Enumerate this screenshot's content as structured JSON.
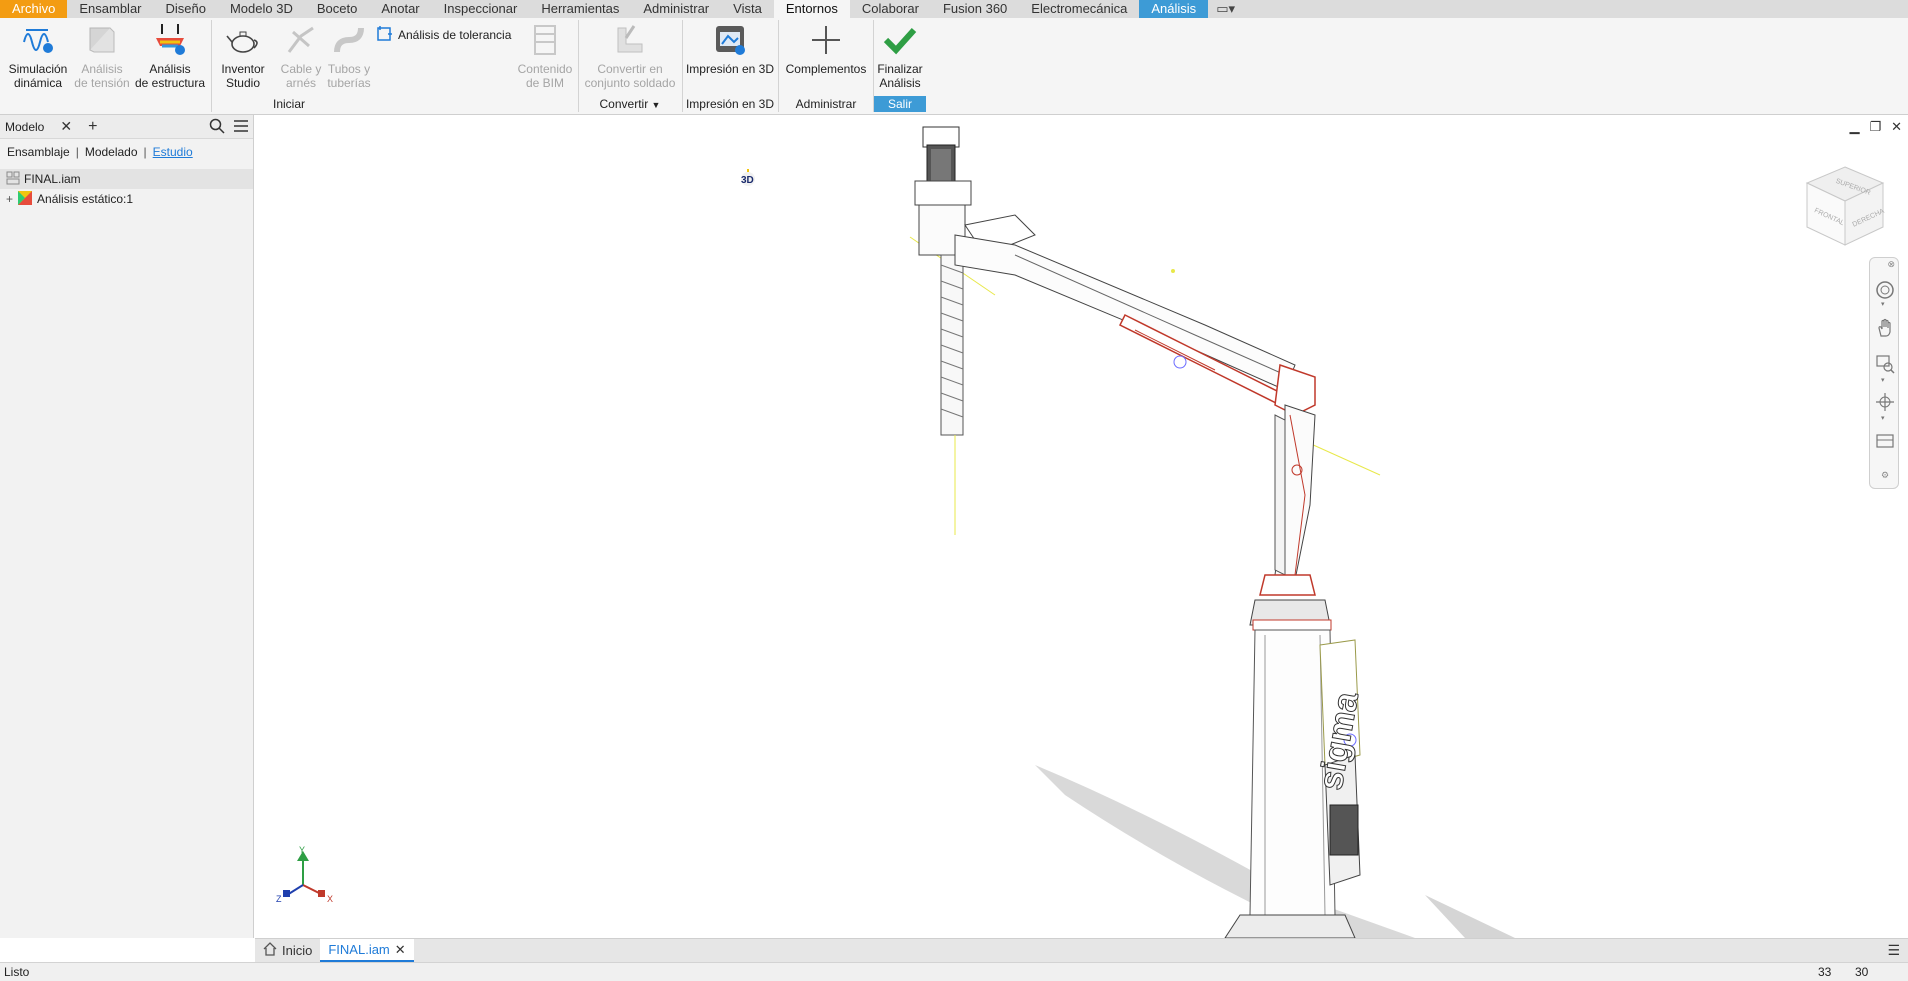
{
  "tabs": [
    {
      "label": "Archivo",
      "kind": "file"
    },
    {
      "label": "Ensamblar",
      "kind": "normal"
    },
    {
      "label": "Diseño",
      "kind": "normal"
    },
    {
      "label": "Modelo 3D",
      "kind": "normal"
    },
    {
      "label": "Boceto",
      "kind": "normal"
    },
    {
      "label": "Anotar",
      "kind": "normal"
    },
    {
      "label": "Inspeccionar",
      "kind": "normal"
    },
    {
      "label": "Herramientas",
      "kind": "normal"
    },
    {
      "label": "Administrar",
      "kind": "normal"
    },
    {
      "label": "Vista",
      "kind": "normal"
    },
    {
      "label": "Entornos",
      "kind": "active"
    },
    {
      "label": "Colaborar",
      "kind": "normal"
    },
    {
      "label": "Fusion 360",
      "kind": "normal"
    },
    {
      "label": "Electromecánica",
      "kind": "normal"
    },
    {
      "label": "Análisis",
      "kind": "analysis"
    }
  ],
  "ribbon": {
    "sim_dinamica": "Simulación\ndinámica",
    "analisis_tension": "Análisis\nde tensión",
    "analisis_estructura": "Análisis\nde estructura",
    "inventor_studio": "Inventor\nStudio",
    "cable_arnes": "Cable y\narnés",
    "tubos_tuberias": "Tubos y\ntuberías",
    "analisis_tolerancia": "Análisis de tolerancia",
    "contenido_bim": "Contenido\nde BIM",
    "convertir_soldado": "Convertir en\nconjunto soldado",
    "impresion_3d": "Impresión en 3D",
    "complementos": "Complementos",
    "finalizar_analisis": "Finalizar\nAnálisis",
    "groups": {
      "iniciar": "Iniciar",
      "convertir": "Convertir",
      "impresion": "Impresión en 3D",
      "administrar": "Administrar",
      "salir": "Salir"
    }
  },
  "browser": {
    "title": "Modelo",
    "modes": {
      "ensamblaje": "Ensamblaje",
      "modelado": "Modelado",
      "estudio": "Estudio"
    },
    "tree": {
      "root": "FINAL.iam",
      "child": "Análisis estático:1"
    }
  },
  "viewcube": {
    "top": "SUPERIOR",
    "front": "FRONTAL",
    "right": "DERECHA"
  },
  "triad": {
    "x": "X",
    "y": "Y",
    "z": "Z"
  },
  "doc_tabs": {
    "home": "Inicio",
    "file": "FINAL.iam"
  },
  "status": {
    "text": "Listo",
    "count1": "33",
    "count2": "30"
  },
  "model_label": "sigma",
  "colors": {
    "accent": "#3d9bd6",
    "file_tab": "#f39c12",
    "check": "#2e9e44"
  }
}
